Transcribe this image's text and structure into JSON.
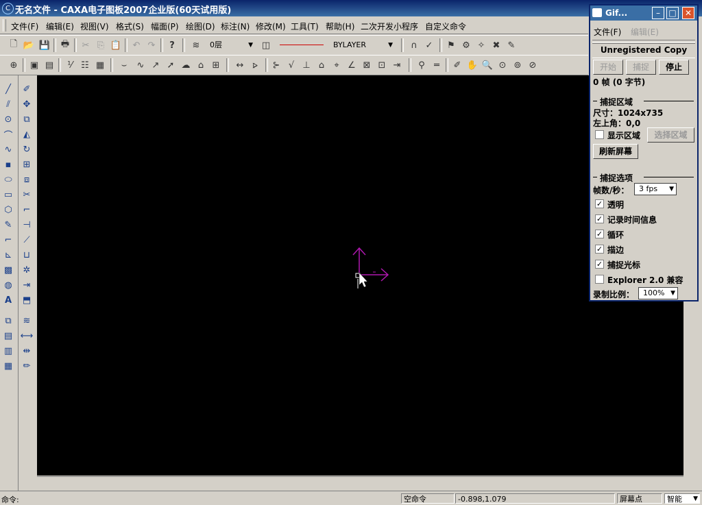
{
  "window": {
    "title": "无名文件 - CAXA电子图板2007企业版(60天试用版)",
    "icon": "app-icon"
  },
  "menu": [
    "文件(F)",
    "编辑(E)",
    "视图(V)",
    "格式(S)",
    "幅面(P)",
    "绘图(D)",
    "标注(N)",
    "修改(M)",
    "工具(T)",
    "帮助(H)",
    "二次开发小程序",
    "自定义命令"
  ],
  "toolbar": {
    "layer_value": "0层",
    "linetype_value": "BYLAYER"
  },
  "colors": {
    "canvas": "#000000",
    "crosshair": "#b018b0",
    "title_gradient_start": "#0a246a",
    "title_gradient_end": "#3a6ea5"
  },
  "status": {
    "command_prompt": "命令:",
    "command_state": "空命令",
    "coordinates": "-0.898,1.079",
    "snap_mode": "屏幕点",
    "snap_select": "智能"
  },
  "gif_window": {
    "title": "Gif...",
    "menu": [
      "文件(F)",
      "编辑(E)"
    ],
    "banner": "Unregistered Copy",
    "buttons": {
      "start": "开始",
      "capture": "捕捉",
      "stop": "停止"
    },
    "frame_info": "0 帧 (0 字节)",
    "capture_region": {
      "heading": "捕捉区域",
      "size": "尺寸：1024x735",
      "top_left": "左上角：0,0",
      "show_region": "显示区域",
      "select_region": "选择区域",
      "refresh": "刷新屏幕"
    },
    "capture_options": {
      "heading": "捕捉选项",
      "fps_label": "帧数/秒：",
      "fps_value": "3 fps",
      "options": [
        {
          "label": "透明",
          "checked": true
        },
        {
          "label": "记录时间信息",
          "checked": true
        },
        {
          "label": "循环",
          "checked": true
        },
        {
          "label": "描边",
          "checked": true
        },
        {
          "label": "捕捉光标",
          "checked": true
        },
        {
          "label": "Explorer 2.0 兼容",
          "checked": false
        }
      ],
      "scale_label": "录制比例：",
      "scale_value": "100%"
    }
  }
}
